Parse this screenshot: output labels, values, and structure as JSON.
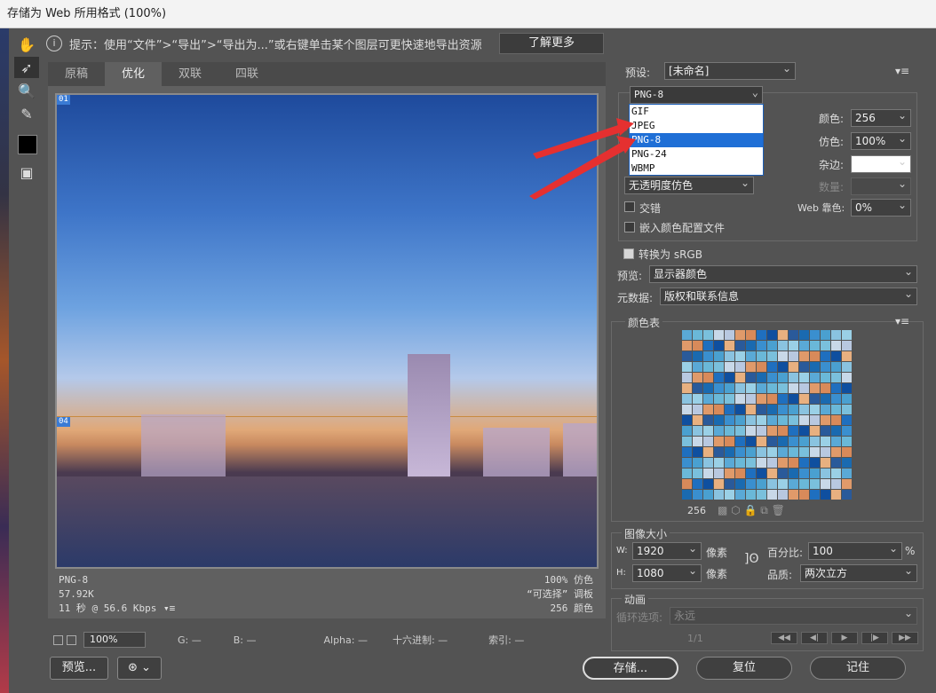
{
  "window": {
    "title": "存储为 Web 所用格式 (100%)"
  },
  "tip": {
    "text": "提示：使用“文件”>“导出”>“导出为...”或右键单击某个图层可更快速地导出资源",
    "learn_more": "了解更多"
  },
  "tabs": [
    "原稿",
    "优化",
    "双联",
    "四联"
  ],
  "slices": {
    "top": "01",
    "bottom": "04"
  },
  "image_stats": {
    "format": "PNG-8",
    "size": "57.92K",
    "speed": "11 秒 @ 56.6 Kbps",
    "dither": "100% 仿色",
    "palette": "“可选择” 调板",
    "colors": "256 颜色"
  },
  "bottom_bar": {
    "zoom": "100%",
    "g": "G: —",
    "b": "B: —",
    "alpha": "Alpha: —",
    "hex": "十六进制: —",
    "index": "索引: —"
  },
  "footer_buttons": {
    "preview": "预览...",
    "save": "存储...",
    "reset": "复位",
    "remember": "记住"
  },
  "preset": {
    "label": "预设:",
    "value": "[未命名]"
  },
  "format": {
    "value": "PNG-8",
    "options": [
      "GIF",
      "JPEG",
      "PNG-8",
      "PNG-24",
      "WBMP"
    ],
    "selected": "PNG-8"
  },
  "settings": {
    "colors_label": "颜色:",
    "colors_value": "256",
    "dither_label": "仿色:",
    "dither_value": "100%",
    "matte_label": "杂边:",
    "transparency_dither": "无透明度仿色",
    "amount_label": "数量:",
    "interlaced": "交错",
    "web_snap_label": "Web 靠色:",
    "web_snap_value": "0%",
    "embed_profile": "嵌入颜色配置文件"
  },
  "convert_srgb": "转换为 sRGB",
  "preview_label": "预览:",
  "preview_value": "显示器颜色",
  "metadata_label": "元数据:",
  "metadata_value": "版权和联系信息",
  "color_table": {
    "label": "颜色表",
    "count": "256"
  },
  "image_size": {
    "label": "图像大小",
    "w_label": "W:",
    "w_value": "1920",
    "w_unit": "像素",
    "h_label": "H:",
    "h_value": "1080",
    "h_unit": "像素",
    "percent_label": "百分比:",
    "percent_value": "100",
    "percent_unit": "%",
    "quality_label": "品质:",
    "quality_value": "两次立方"
  },
  "animation": {
    "label": "动画",
    "loop_label": "循环选项:",
    "loop_value": "永远",
    "frame": "1/1"
  },
  "palette_colors": [
    "#5aa9d6",
    "#1f6fbf",
    "#8ac3e0",
    "#e09a6a",
    "#3a8fcf",
    "#c8d8e8",
    "#2a5a9a",
    "#6ab8d8",
    "#0f4f9f",
    "#9ad0e6",
    "#d88a5a",
    "#4aa0d0",
    "#b8c8e0",
    "#1a6ab0",
    "#7ac0dc",
    "#e8b080"
  ]
}
